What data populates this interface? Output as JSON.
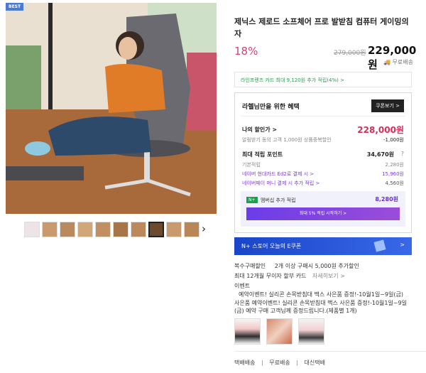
{
  "badge": "BEST",
  "product": {
    "title": "제닉스 제로드 소프체어 프로 발받침 컴퓨터 게이밍의자",
    "discount": "18%",
    "original_price": "279,000원",
    "price": "229,000원",
    "shipping_tag": "무료배송"
  },
  "card_promo": "라인프렌즈 카드 최대 9,120원 추가 적립(4%) >",
  "benefit": {
    "heading": "라헬님만을 위한 혜택",
    "coupon_button": "쿠폰보기 >",
    "my_price_label": "나의 할인가 >",
    "my_price": "228,000원",
    "alarm_label": "알림받기 동의 고객 1,000원 상품중복할인",
    "alarm_value": "-1,000원",
    "points_label": "최대 적립 포인트",
    "points_value": "34,670원",
    "points_help": "?",
    "basic_label": "기본적립",
    "basic_value": "2,280원",
    "naver_card_label": "네이버 현대카드 Ed2로 결제 시 >",
    "naver_card_value": "15,960원",
    "naverpay_label": "네이버페이 머니 결제 시 추가 적립 >",
    "naverpay_value": "4,560원",
    "membership_badge": "N+",
    "membership_label": "멤버십 추가 적립",
    "membership_value": "8,280원",
    "membership_button": "최대 5% 적립 시작하기 >"
  },
  "banner": {
    "text": "N+ 스토어 오늘의 E쿠폰",
    "arrow": ">"
  },
  "info": {
    "bulk_label": "복수구매할인",
    "bulk_value": "2개 이상 구매시 5,000원 추가할인",
    "installment": "최대 12개월 무이자 할부 카드",
    "installment_link": "자세히보기 >",
    "event_label": "이벤트",
    "event_text": "예약이벤트! 실리콘 손목받침대 맥스 사은품 증정!-10월1일~9일(금)",
    "gift_label": "사은품",
    "gift_text": "예약이벤트! 실리콘 손목받침대 맥스 사은품 증정!-10월1일~9일(금) 예약 구매 고객님께 증정드립니다.(제품별 1개)"
  },
  "shipping": {
    "a": "택배배송",
    "b": "무료배송",
    "c": "대신택배"
  },
  "thumbnail_count": 11,
  "selected_thumbnail": 8
}
